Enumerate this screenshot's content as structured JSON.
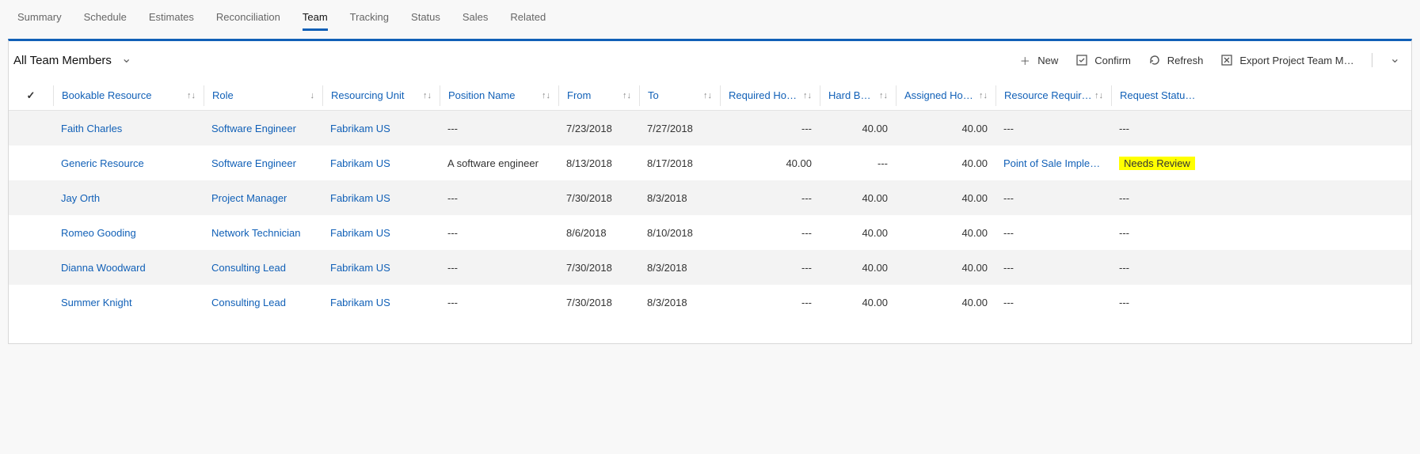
{
  "tabs": [
    {
      "label": "Summary",
      "active": false
    },
    {
      "label": "Schedule",
      "active": false
    },
    {
      "label": "Estimates",
      "active": false
    },
    {
      "label": "Reconciliation",
      "active": false
    },
    {
      "label": "Team",
      "active": true
    },
    {
      "label": "Tracking",
      "active": false
    },
    {
      "label": "Status",
      "active": false
    },
    {
      "label": "Sales",
      "active": false
    },
    {
      "label": "Related",
      "active": false
    }
  ],
  "view": {
    "title": "All Team Members"
  },
  "commands": {
    "new": "New",
    "confirm": "Confirm",
    "refresh": "Refresh",
    "export": "Export Project Team M…"
  },
  "columns": {
    "bookable_resource": "Bookable Resource",
    "role": "Role",
    "resourcing_unit": "Resourcing Unit",
    "position_name": "Position Name",
    "from": "From",
    "to": "To",
    "required_hours": "Required Hours",
    "hard_book": "Hard Boo...",
    "assigned_hours": "Assigned Hours",
    "resource_req": "Resource Require...",
    "request_status": "Request Status (..."
  },
  "rows": [
    {
      "resource": "Faith Charles",
      "role": "Software Engineer",
      "unit": "Fabrikam US",
      "position": "---",
      "from": "7/23/2018",
      "to": "7/27/2018",
      "required": "---",
      "hard": "40.00",
      "assigned": "40.00",
      "req": "---",
      "req_link": false,
      "status": "---",
      "status_hl": false
    },
    {
      "resource": "Generic Resource",
      "role": "Software Engineer",
      "unit": "Fabrikam US",
      "position": "A software engineer",
      "from": "8/13/2018",
      "to": "8/17/2018",
      "required": "40.00",
      "hard": "---",
      "assigned": "40.00",
      "req": "Point of Sale Impleme...",
      "req_link": true,
      "status": "Needs Review",
      "status_hl": true
    },
    {
      "resource": "Jay Orth",
      "role": "Project Manager",
      "unit": "Fabrikam US",
      "position": "---",
      "from": "7/30/2018",
      "to": "8/3/2018",
      "required": "---",
      "hard": "40.00",
      "assigned": "40.00",
      "req": "---",
      "req_link": false,
      "status": "---",
      "status_hl": false
    },
    {
      "resource": "Romeo Gooding",
      "role": "Network Technician",
      "unit": "Fabrikam US",
      "position": "---",
      "from": "8/6/2018",
      "to": "8/10/2018",
      "required": "---",
      "hard": "40.00",
      "assigned": "40.00",
      "req": "---",
      "req_link": false,
      "status": "---",
      "status_hl": false
    },
    {
      "resource": "Dianna Woodward",
      "role": "Consulting Lead",
      "unit": "Fabrikam US",
      "position": "---",
      "from": "7/30/2018",
      "to": "8/3/2018",
      "required": "---",
      "hard": "40.00",
      "assigned": "40.00",
      "req": "---",
      "req_link": false,
      "status": "---",
      "status_hl": false
    },
    {
      "resource": "Summer Knight",
      "role": "Consulting Lead",
      "unit": "Fabrikam US",
      "position": "---",
      "from": "7/30/2018",
      "to": "8/3/2018",
      "required": "---",
      "hard": "40.00",
      "assigned": "40.00",
      "req": "---",
      "req_link": false,
      "status": "---",
      "status_hl": false
    }
  ],
  "icons": {
    "sort_both": "↑↓",
    "sort_down": "↓",
    "check": "✓",
    "plus": "＋"
  }
}
